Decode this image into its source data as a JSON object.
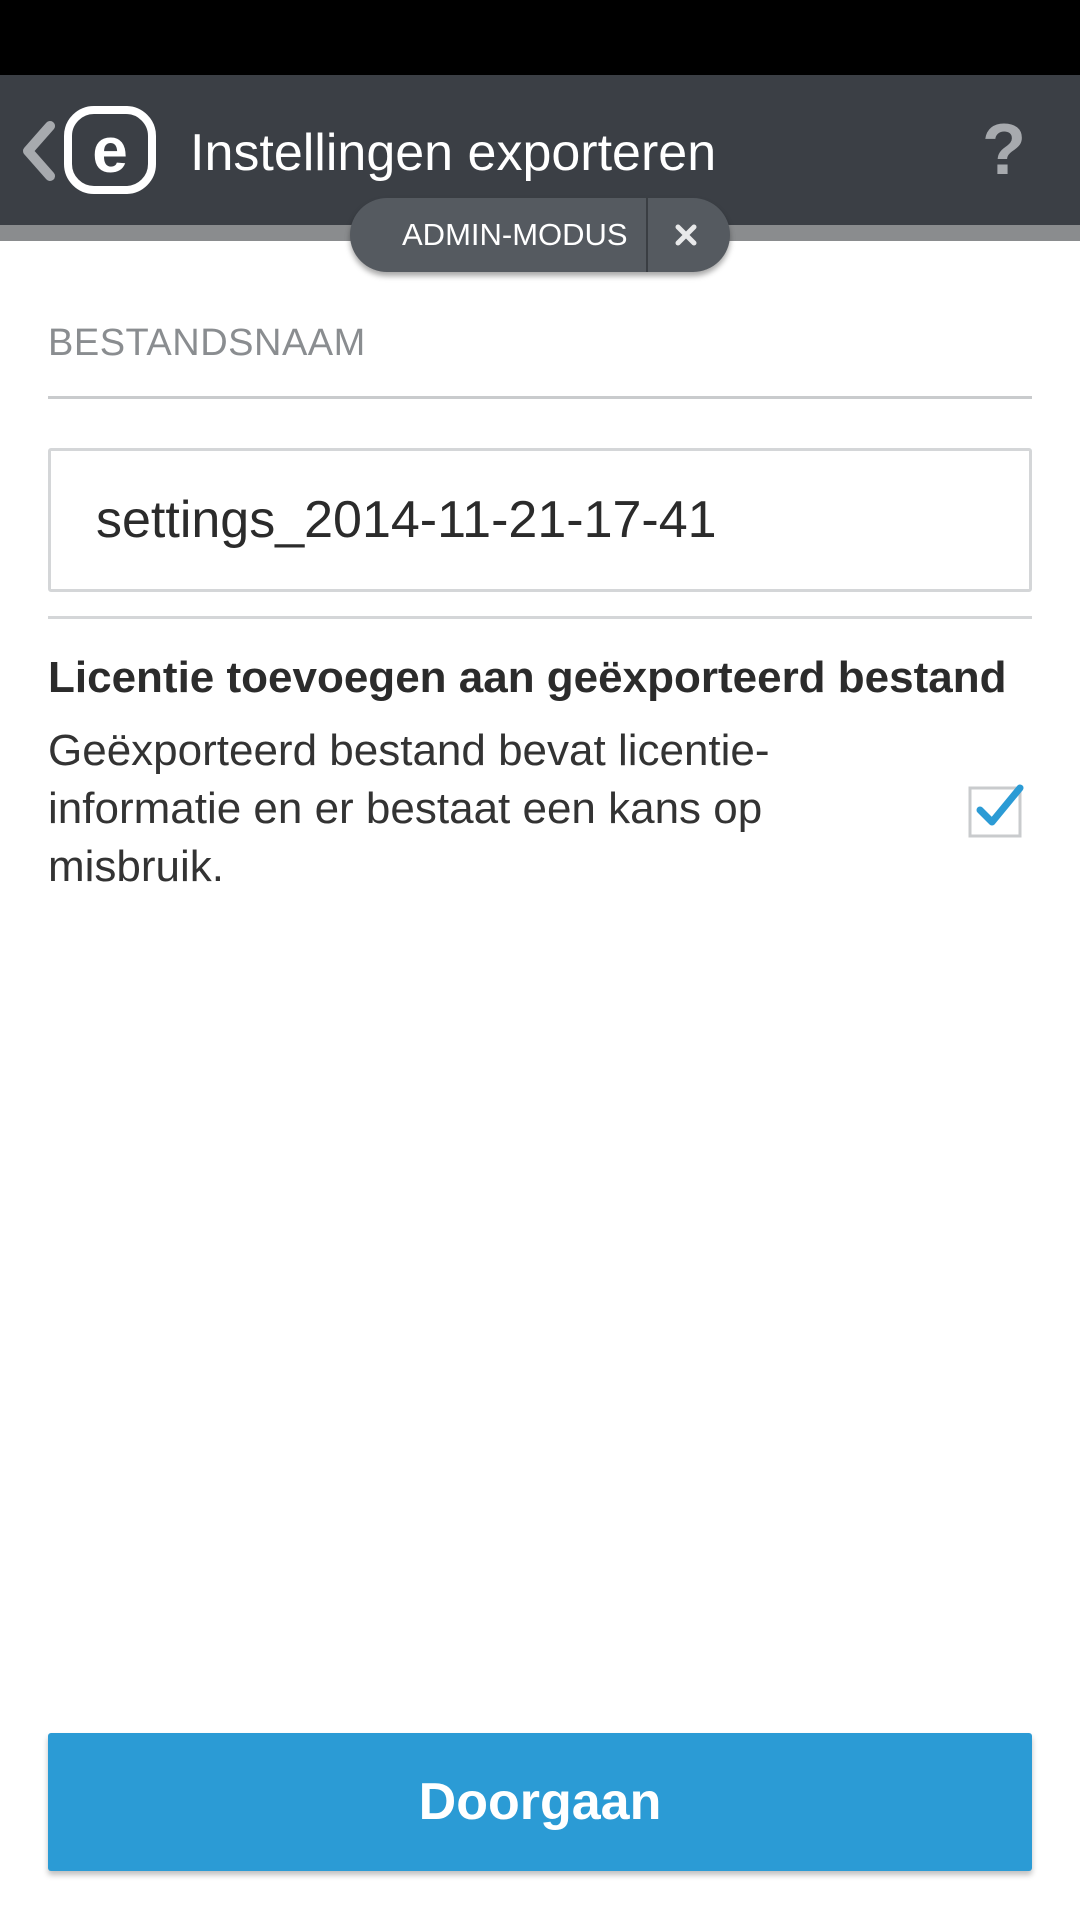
{
  "app_bar": {
    "title": "Instellingen exporteren",
    "help_label": "?",
    "logo_letter": "e",
    "background": "#3b3f45"
  },
  "admin_mode": {
    "label": "ADMIN-MODUS"
  },
  "form": {
    "section_label": "BESTANDSNAAM",
    "filename_value": "settings_2014-11-21-17-41",
    "option_title": "Licentie toevoegen aan geëxporteerd bestand",
    "option_description": "Geëxporteerd bestand bevat licentie-informatie en er bestaat een kans op misbruik.",
    "license_checkbox_checked": true
  },
  "actions": {
    "continue_label": "Doorgaan",
    "accent": "#2b9bd5"
  },
  "icons": {
    "back": "chevron-left-icon",
    "logo": "eset-logo",
    "help": "help-icon",
    "close": "close-icon",
    "check": "check-icon"
  }
}
